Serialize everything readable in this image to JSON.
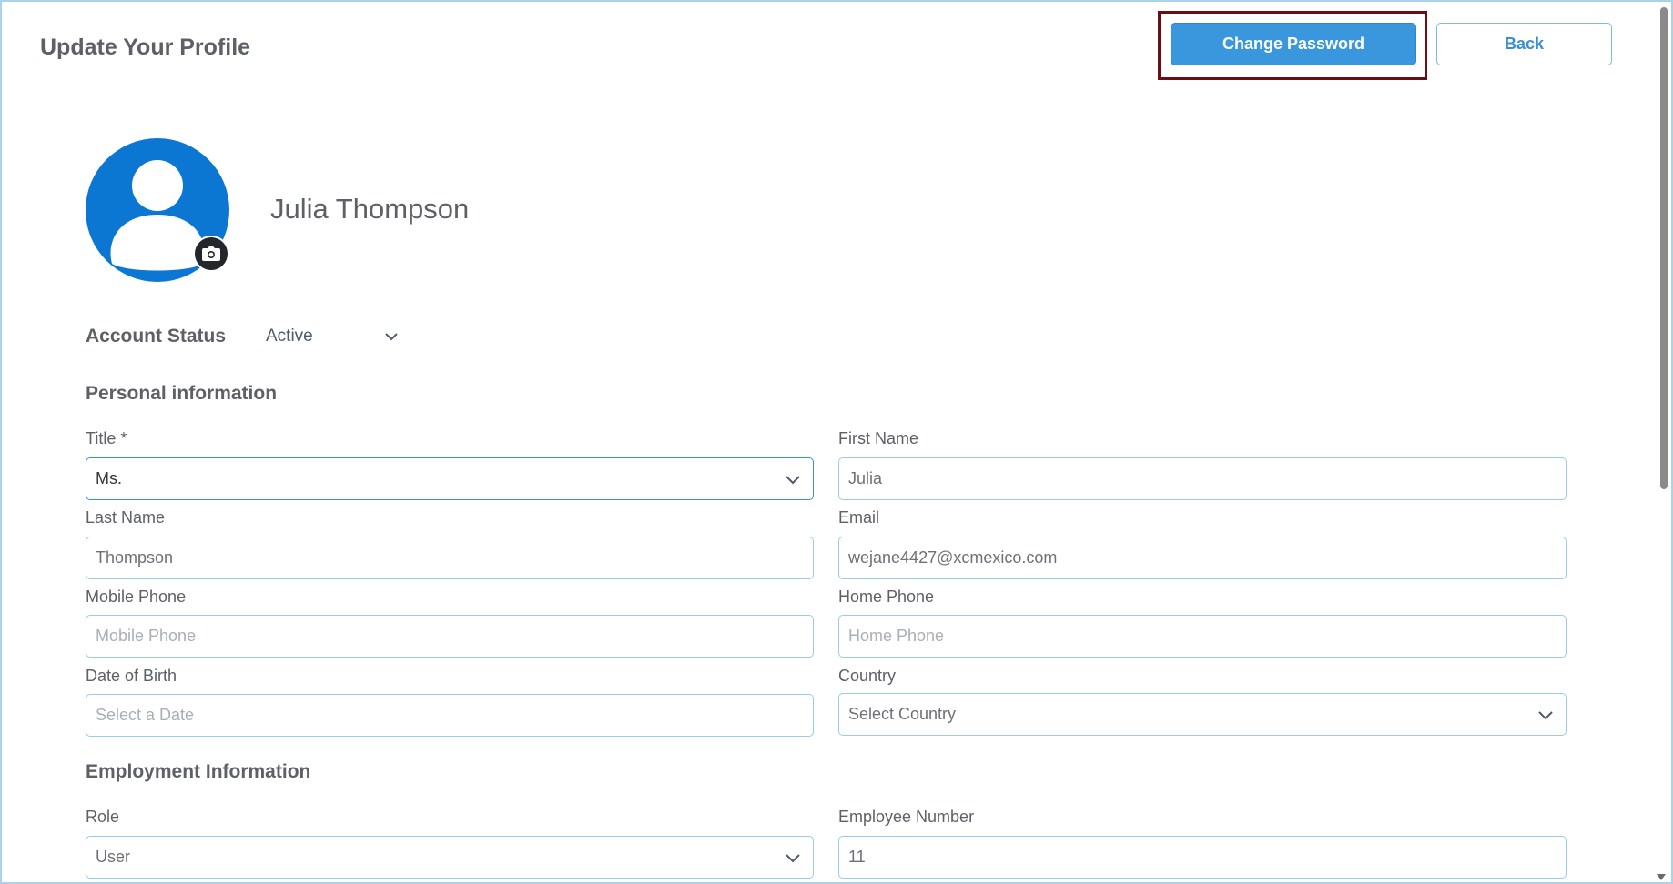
{
  "header": {
    "title": "Update Your Profile",
    "change_password_label": "Change Password",
    "back_label": "Back"
  },
  "profile": {
    "name": "Julia Thompson",
    "avatar_color": "#0c77d3"
  },
  "account_status": {
    "label": "Account Status",
    "value": "Active"
  },
  "personal": {
    "section_title": "Personal information",
    "title_label": "Title *",
    "title_value": "Ms.",
    "first_name_label": "First Name",
    "first_name_value": "Julia",
    "last_name_label": "Last Name",
    "last_name_value": "Thompson",
    "email_label": "Email",
    "email_value": "wejane4427@xcmexico.com",
    "mobile_label": "Mobile Phone",
    "mobile_placeholder": "Mobile Phone",
    "home_label": "Home Phone",
    "home_placeholder": "Home Phone",
    "dob_label": "Date of Birth",
    "dob_placeholder": "Select a Date",
    "country_label": "Country",
    "country_placeholder": "Select Country"
  },
  "employment": {
    "section_title": "Employment Information",
    "role_label": "Role",
    "role_value": "User",
    "employee_number_label": "Employee Number",
    "employee_number_value": "11"
  },
  "colors": {
    "primary": "#3a97dd",
    "highlight_border": "#6b0d14",
    "field_border": "#9ccbe8"
  }
}
